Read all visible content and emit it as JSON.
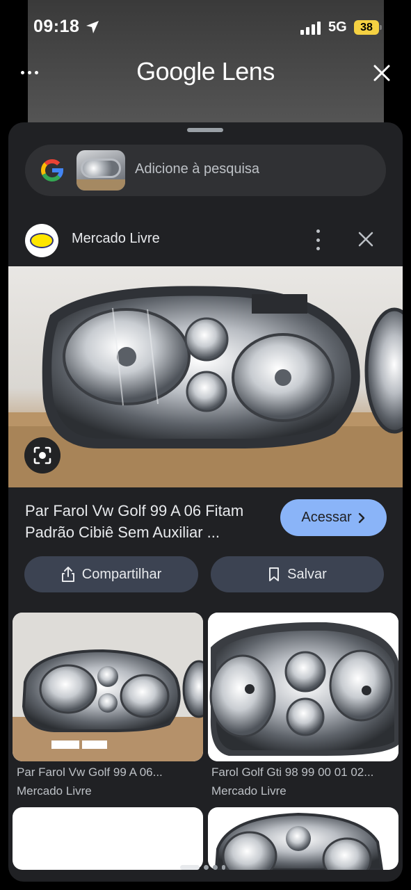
{
  "status": {
    "time": "09:18",
    "network": "5G",
    "battery": "38"
  },
  "header": {
    "title": "Google Lens"
  },
  "search": {
    "placeholder": "Adicione à pesquisa"
  },
  "source": {
    "name": "Mercado Livre"
  },
  "product": {
    "title": "Par Farol Vw Golf 99 A 06 Fitam Padrão Cibiê Sem Auxiliar ...",
    "access_label": "Acessar",
    "share_label": "Compartilhar",
    "save_label": "Salvar"
  },
  "results": [
    {
      "title": "Par Farol Vw Golf 99 A 06...",
      "source": "Mercado Livre"
    },
    {
      "title": "Farol Golf Gti 98 99 00 01 02...",
      "source": "Mercado Livre"
    }
  ],
  "colors": {
    "accent": "#8ab4f8",
    "sheet": "#202124",
    "pill": "#3c4352",
    "battery": "#f5d142"
  }
}
